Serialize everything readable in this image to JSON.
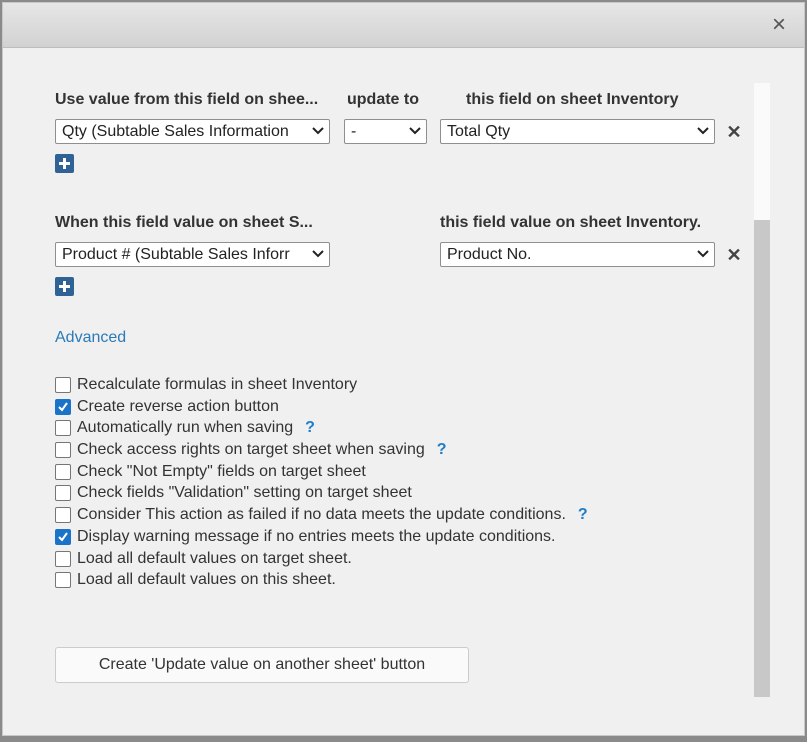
{
  "dialog": {
    "close_glyph": "×"
  },
  "mapping": {
    "header_source": "Use value from this field on shee...",
    "header_update": "update to",
    "header_target": "this field on sheet Inventory",
    "source_value": "Qty (Subtable Sales Information",
    "operator_value": "-",
    "target_value": "Total Qty"
  },
  "condition": {
    "header_source": "When this field value on sheet S...",
    "header_target": "this field value on sheet Inventory.",
    "source_value": "Product # (Subtable Sales Inforr",
    "target_value": "Product No."
  },
  "advanced_label": "Advanced",
  "options": [
    {
      "label": "Recalculate formulas in sheet Inventory",
      "checked": false,
      "help": false
    },
    {
      "label": "Create reverse action button",
      "checked": true,
      "help": false
    },
    {
      "label": "Automatically run when saving",
      "checked": false,
      "help": true
    },
    {
      "label": "Check access rights on target sheet when saving",
      "checked": false,
      "help": true
    },
    {
      "label": "Check \"Not Empty\" fields on target sheet",
      "checked": false,
      "help": false
    },
    {
      "label": "Check fields \"Validation\" setting on target sheet",
      "checked": false,
      "help": false
    },
    {
      "label": "Consider This action as failed if no data meets the update conditions.",
      "checked": false,
      "help": true
    },
    {
      "label": "Display warning message if no entries meets the update conditions.",
      "checked": true,
      "help": false
    },
    {
      "label": "Load all default values on target sheet.",
      "checked": false,
      "help": false
    },
    {
      "label": "Load all default values on this sheet.",
      "checked": false,
      "help": false
    }
  ],
  "help_glyph": "?",
  "remove_glyph": "✕",
  "create_button_label": "Create 'Update value on another sheet' button",
  "colors": {
    "accent": "#1a73c9",
    "link": "#2a7ab9",
    "add_button": "#2f6396"
  }
}
